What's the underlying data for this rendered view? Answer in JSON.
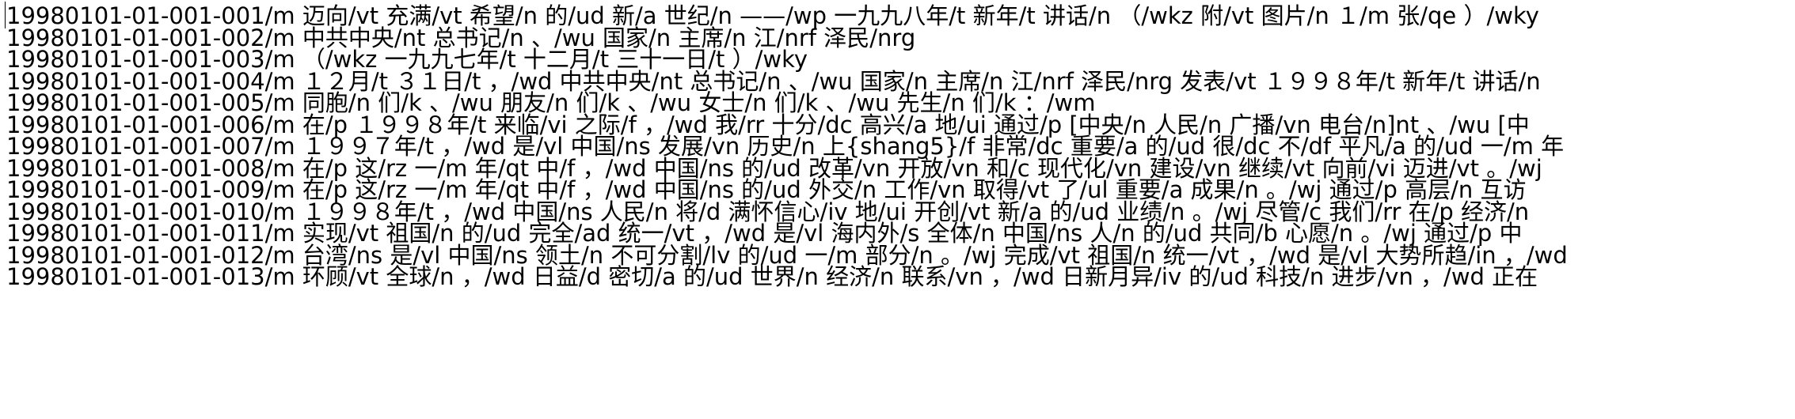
{
  "document": {
    "lines": [
      "19980101-01-001-001/m 迈向/vt 充满/vt 希望/n 的/ud 新/a 世纪/n ——/wp 一九九八年/t 新年/t 讲话/n （/wkz 附/vt 图片/n １/m 张/qe ）/wky",
      "19980101-01-001-002/m 中共中央/nt 总书记/n 、/wu 国家/n 主席/n 江/nrf 泽民/nrg",
      "19980101-01-001-003/m （/wkz 一九九七年/t 十二月/t 三十一日/t ）/wky",
      "19980101-01-001-004/m １２月/t ３１日/t ，/wd 中共中央/nt 总书记/n 、/wu 国家/n 主席/n 江/nrf 泽民/nrg 发表/vt １９９８年/t 新年/t 讲话/n",
      "19980101-01-001-005/m 同胞/n 们/k 、/wu 朋友/n 们/k 、/wu 女士/n 们/k 、/wu 先生/n 们/k ：/wm",
      "19980101-01-001-006/m 在/p １９９８年/t 来临/vi 之际/f ，/wd 我/rr 十分/dc 高兴/a 地/ui 通过/p [中央/n 人民/n 广播/vn 电台/n]nt 、/wu [中",
      "19980101-01-001-007/m １９９７年/t ，/wd 是/vl 中国/ns 发展/vn 历史/n 上{shang5}/f 非常/dc 重要/a 的/ud 很/dc 不/df 平凡/a 的/ud 一/m 年",
      "19980101-01-001-008/m 在/p 这/rz 一/m 年/qt 中/f ，/wd 中国/ns 的/ud 改革/vn 开放/vn 和/c 现代化/vn 建设/vn 继续/vt 向前/vi 迈进/vt 。/wj",
      "19980101-01-001-009/m 在/p 这/rz 一/m 年/qt 中/f ，/wd 中国/ns 的/ud 外交/n 工作/vn 取得/vt 了/ul 重要/a 成果/n 。/wj 通过/p 高层/n 互访",
      "19980101-01-001-010/m １９９８年/t ，/wd 中国/ns 人民/n 将/d 满怀信心/iv 地/ui 开创/vt 新/a 的/ud 业绩/n 。/wj 尽管/c 我们/rr 在/p 经济/n",
      "19980101-01-001-011/m 实现/vt 祖国/n 的/ud 完全/ad 统一/vt ，/wd 是/vl 海内外/s 全体/n 中国/ns 人/n 的/ud 共同/b 心愿/n 。/wj 通过/p 中",
      "19980101-01-001-012/m 台湾/ns 是/vl 中国/ns 领土/n 不可分割/lv 的/ud 一/m 部分/n 。/wj 完成/vt 祖国/n 统一/vt ，/wd 是/vl 大势所趋/in ，/wd",
      "19980101-01-001-013/m 环顾/vt 全球/n ，/wd 日益/d 密切/a 的/ud 世界/n 经济/n 联系/vn ，/wd 日新月异/iv 的/ud 科技/n 进步/vn ，/wd 正在"
    ]
  }
}
